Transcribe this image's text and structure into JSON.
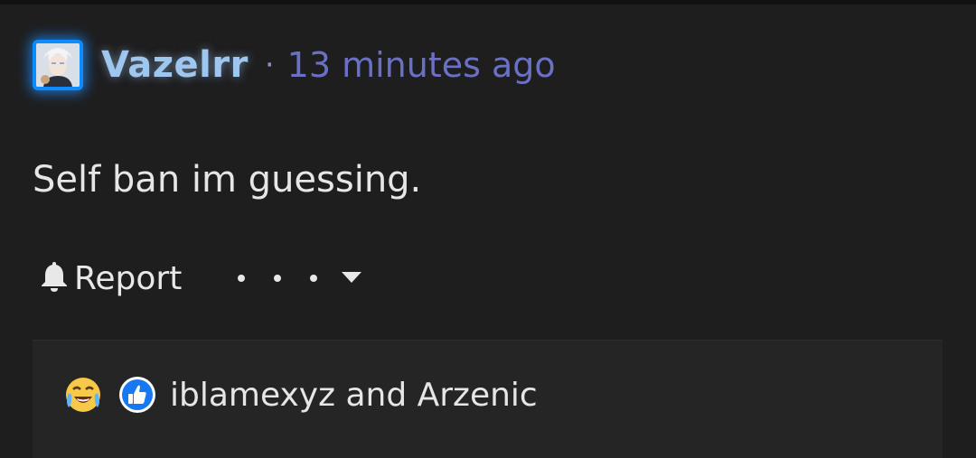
{
  "post": {
    "author": "Vazelrr",
    "separator": "·",
    "timestamp": "13 minutes ago",
    "body": "Self ban im guessing."
  },
  "actions": {
    "report_label": "Report",
    "report_icon": "bell-icon",
    "more_icon": "ellipsis-icon",
    "dropdown_icon": "caret-down-icon"
  },
  "reactions": {
    "icons": [
      "laughing-crying-icon",
      "thumbs-up-icon"
    ],
    "reactors_text": "iblamexyz and Arzenic"
  },
  "colors": {
    "background": "#1e1e1f",
    "username": "#9fc6ee",
    "timestamp": "#6a70c4",
    "avatar_border": "#0d8cff",
    "like_badge": "#1877f2"
  }
}
